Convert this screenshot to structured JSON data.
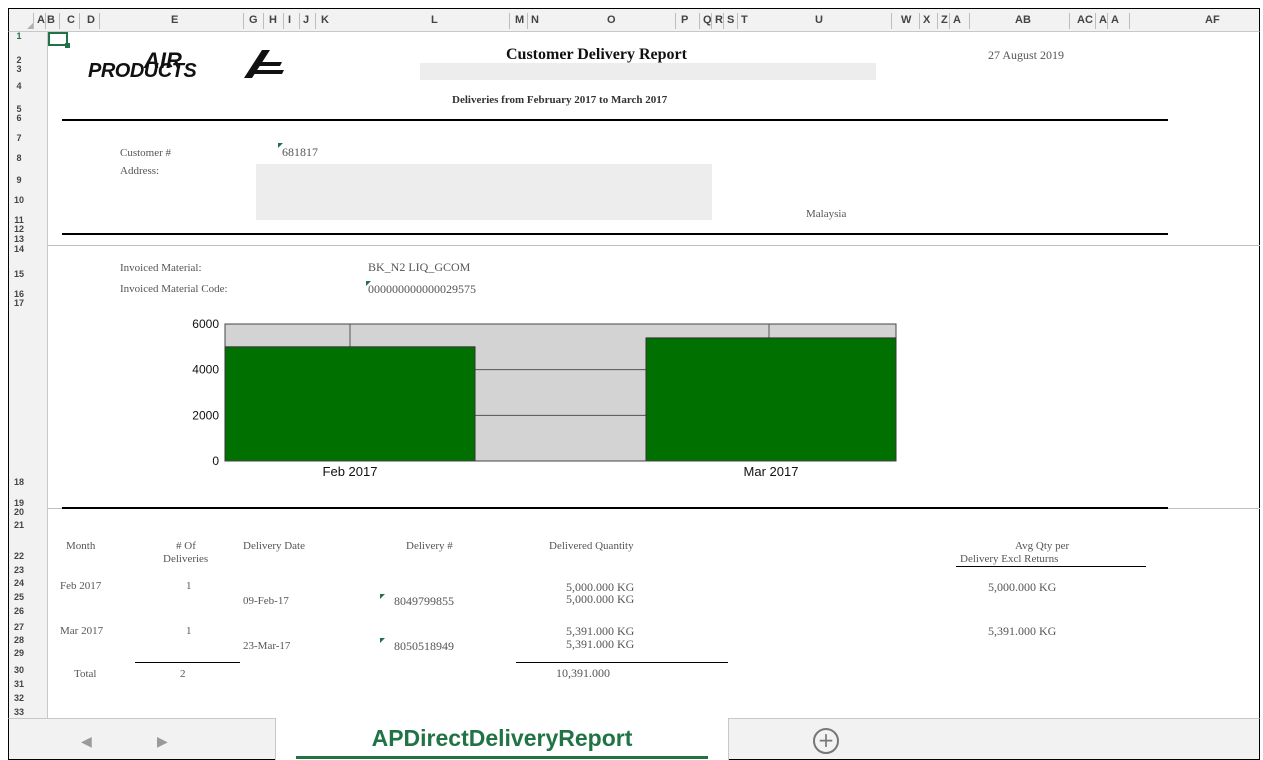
{
  "columns": [
    "A",
    "B",
    "C",
    "D",
    "E",
    "G",
    "H",
    "I",
    "J",
    "K",
    "L",
    "M",
    "N",
    "O",
    "P",
    "Q",
    "R",
    "S",
    "T",
    "U",
    "W",
    "X",
    "Z",
    "A",
    "AB",
    "AC",
    "A",
    "A",
    "AF"
  ],
  "rows": [
    "1",
    "2",
    "3",
    "4",
    "5",
    "6",
    "7",
    "8",
    "9",
    "10",
    "11",
    "12",
    "13",
    "14",
    "15",
    "16",
    "17",
    "18",
    "19",
    "20",
    "21",
    "22",
    "23",
    "24",
    "25",
    "26",
    "27",
    "28",
    "29",
    "30",
    "31",
    "32",
    "33"
  ],
  "logo": {
    "line1": "AIR",
    "line2": "PRODUCTS",
    "icon": "air-products-logo-icon"
  },
  "report": {
    "title": "Customer Delivery Report",
    "date": "27 August 2019",
    "subtitle": "Deliveries from February 2017 to March 2017"
  },
  "customer": {
    "number_label": "Customer #",
    "number": "681817",
    "address_label": "Address:",
    "country": "Malaysia"
  },
  "material": {
    "name_label": "Invoiced Material:",
    "name": "BK_N2 LIQ_GCOM",
    "code_label": "Invoiced Material Code:",
    "code": "000000000000029575"
  },
  "chart_data": {
    "type": "bar",
    "categories": [
      "Feb 2017",
      "Mar 2017"
    ],
    "values": [
      5000,
      5391
    ],
    "yticks": [
      "0",
      "2000",
      "4000",
      "6000"
    ],
    "ylim": [
      0,
      6000
    ],
    "bar_color": "#007000",
    "plot_bg": "#d3d3d3"
  },
  "table": {
    "headers": {
      "month": "Month",
      "num1": "# Of",
      "num2": "Deliveries",
      "date": "Delivery Date",
      "delivery": "Delivery #",
      "qty": "Delivered Quantity",
      "avg1": "Avg Qty per",
      "avg2": "Delivery Excl Returns"
    },
    "groups": [
      {
        "month": "Feb 2017",
        "count": "1",
        "month_qty": "5,000.000 KG",
        "avg": "5,000.000 KG",
        "date": "09-Feb-17",
        "delivery": "8049799855",
        "qty": "5,000.000 KG"
      },
      {
        "month": "Mar 2017",
        "count": "1",
        "month_qty": "5,391.000 KG",
        "avg": "5,391.000 KG",
        "date": "23-Mar-17",
        "delivery": "8050518949",
        "qty": "5,391.000 KG"
      }
    ],
    "total_label": "Total",
    "total_count": "2",
    "total_qty": "10,391.000"
  },
  "tabs": {
    "prev": "◀",
    "next": "▶",
    "active": "APDirectDeliveryReport",
    "add": "+"
  },
  "colors": {
    "excel_green": "#217346",
    "bar_green": "#007000"
  }
}
